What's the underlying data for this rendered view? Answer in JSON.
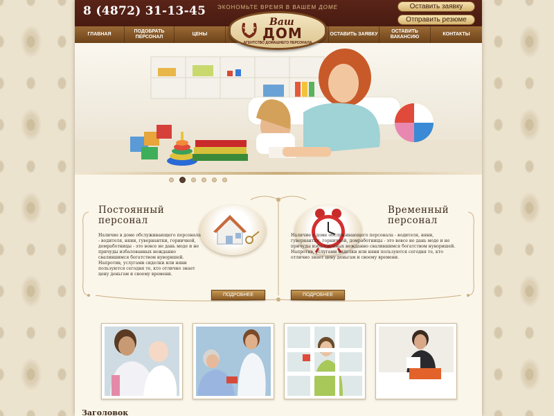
{
  "header": {
    "phone": "8 (4872) 31-13-45",
    "slogan": "ЭКОНОМЬТЕ ВРЕМЯ В ВАШЕМ ДОМЕ",
    "btn_request": "Оставить заявку",
    "btn_resume": "Отправить резюме",
    "logo": {
      "line1": "Ваш",
      "line2": "ДОМ",
      "subtitle": "АГЕНТСТВО ДОМАШНЕГО ПЕРСОНАЛА",
      "icon": "horseshoe-icon"
    }
  },
  "nav": {
    "items": [
      {
        "label": "ГЛАВНАЯ"
      },
      {
        "label": "ПОДОБРАТЬ ПЕРСОНАЛ"
      },
      {
        "label": "ЦЕНЫ"
      },
      {
        "label": "ОСТАВИТЬ ЗАЯВКУ"
      },
      {
        "label": "ОСТАВИТЬ ВАКАНСИЮ"
      },
      {
        "label": "КОНТАКТЫ"
      }
    ]
  },
  "slider": {
    "active_index": 1,
    "count": 6
  },
  "services": [
    {
      "title": "Постоянный персонал",
      "text": "Наличие в доме обслуживающего персонала - водителя, няни, гувернантки, горничной, домработницы - это вовсе не дань моде и не причуды избалованных нежданно свалившимся богатством нуворишей. Напротив, услугами сиделки или няни пользуются сегодня те, кто отлично знает цену деньгам и своему времени.",
      "button": "ПОДРОБНЕЕ",
      "icon": "house-key-icon"
    },
    {
      "title": "Временный персонал",
      "text": "Наличие в доме обслуживающего персонала - водителя, няни, гувернантки, горничной, домработницы - это вовсе не дань моде и не причуды избалованных нежданно свалившимся богатством нуворишей. Напротив, услугами сиделки или няни пользуются сегодня те, кто отлично знает цену деньгам и своему времени.",
      "button": "ПОДРОБНЕЕ",
      "icon": "alarm-clock-icon"
    }
  ],
  "photos": [
    {
      "name": "nurse-with-baby"
    },
    {
      "name": "caregiver-with-elderly"
    },
    {
      "name": "window-cleaning"
    },
    {
      "name": "maid-making-bed"
    }
  ],
  "section_heading": "Заголовок",
  "colors": {
    "header_dark": "#3d150d",
    "nav_brown": "#7d4f20",
    "gold": "#d5b470",
    "page_bg": "#fbf6ea"
  }
}
